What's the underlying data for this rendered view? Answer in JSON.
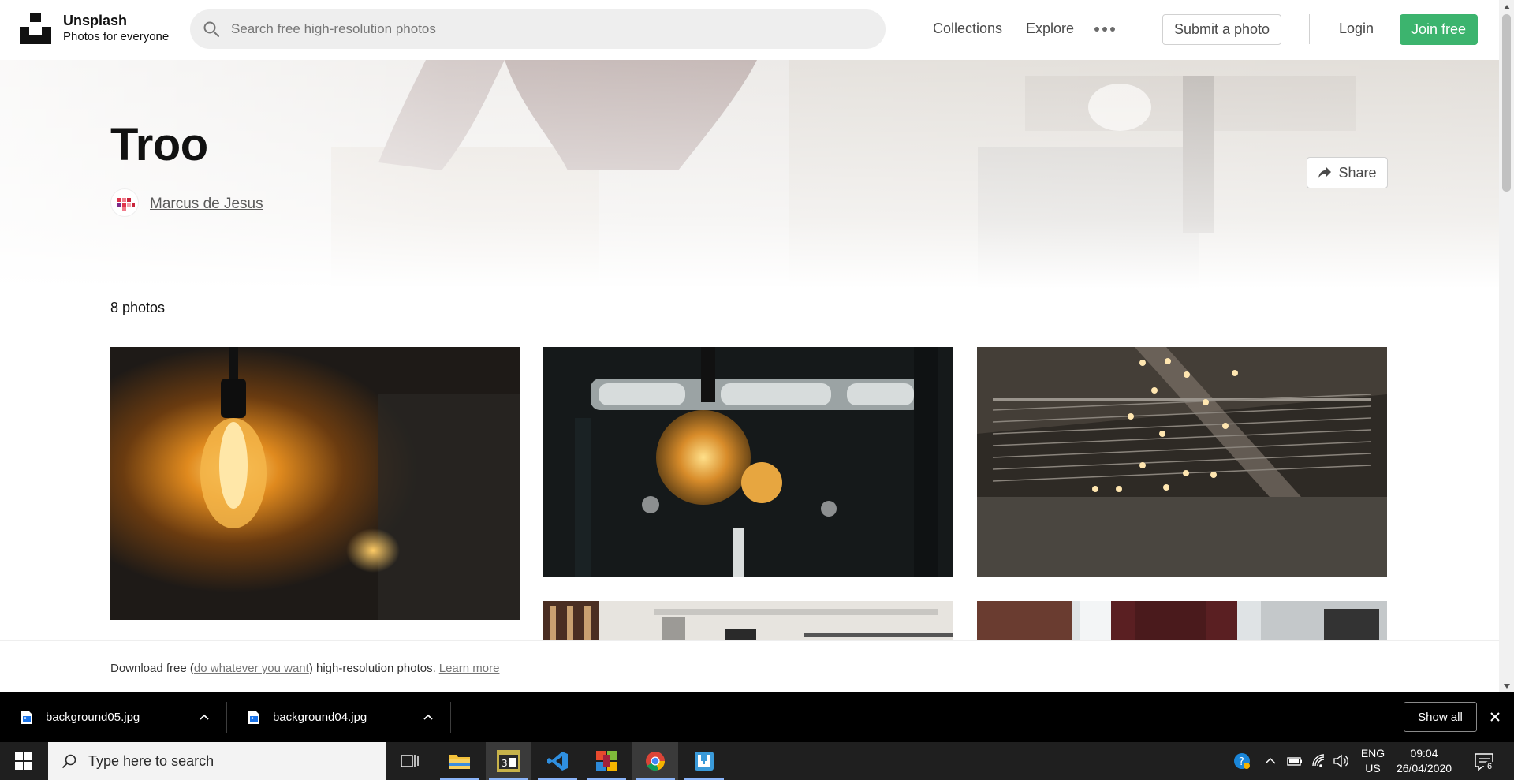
{
  "header": {
    "brand_name": "Unsplash",
    "brand_tagline": "Photos for everyone",
    "search_placeholder": "Search free high-resolution photos",
    "nav": {
      "collections": "Collections",
      "explore": "Explore",
      "submit": "Submit a photo",
      "login": "Login",
      "join": "Join free"
    },
    "accent_color": "#3cb46e"
  },
  "collection": {
    "title": "Troo",
    "author": "Marcus de Jesus",
    "share_label": "Share",
    "photo_count": "8 photos"
  },
  "photos": [
    {
      "subject": "edison-bulb-wall"
    },
    {
      "subject": "edison-bulbs-window"
    },
    {
      "subject": "string-lights-stairs"
    },
    {
      "subject": "workspace-ceiling"
    },
    {
      "subject": "person-red-shirt"
    }
  ],
  "promo": {
    "prefix": "Download free (",
    "link_text": "do whatever you want",
    "suffix": ") high-resolution photos.",
    "learn_more": "Learn more"
  },
  "downloads": {
    "items": [
      {
        "name": "background05.jpg"
      },
      {
        "name": "background04.jpg"
      }
    ],
    "show_all": "Show all"
  },
  "taskbar": {
    "search_placeholder": "Type here to search",
    "apps": [
      "task-view-icon",
      "file-explorer-icon",
      "video-editor-icon",
      "vscode-icon",
      "office-icon",
      "chrome-icon",
      "app-icon"
    ],
    "lang_line1": "ENG",
    "lang_line2": "US",
    "time": "09:04",
    "date": "26/04/2020",
    "notification_count": "6"
  }
}
